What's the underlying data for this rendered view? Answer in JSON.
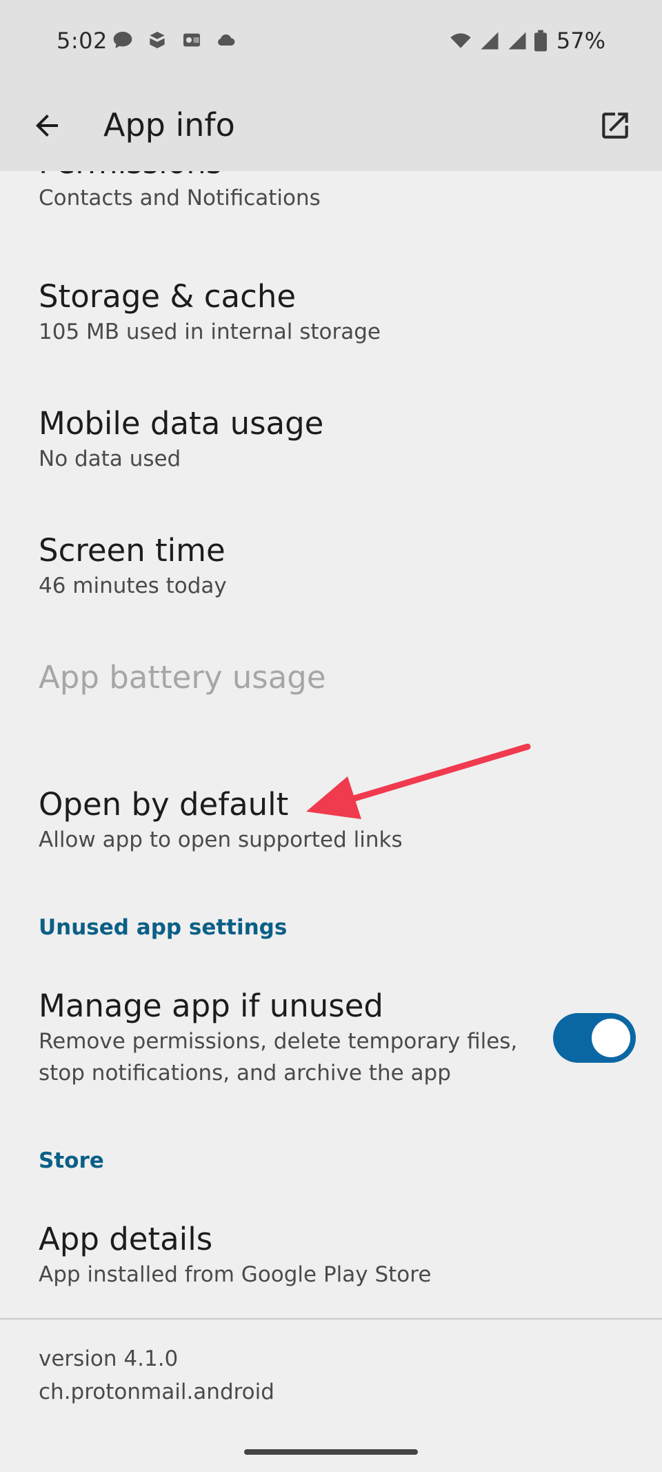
{
  "status_bar": {
    "time": "5:02",
    "battery": "57%",
    "icons_left": [
      "chat-bubble-icon",
      "notification-app-icon",
      "outlook-icon",
      "cloud-icon"
    ],
    "icons_right": [
      "wifi-icon",
      "signal-icon",
      "signal-icon-2",
      "battery-icon"
    ]
  },
  "app_bar": {
    "title": "App info",
    "back_icon": "arrow-back-icon",
    "action_icon": "open-in-new-icon"
  },
  "items": [
    {
      "title": "Permissions",
      "subtitle": "Contacts and Notifications"
    },
    {
      "title": "Storage & cache",
      "subtitle": "105 MB used in internal storage"
    },
    {
      "title": "Mobile data usage",
      "subtitle": "No data used"
    },
    {
      "title": "Screen time",
      "subtitle": "46 minutes today"
    },
    {
      "title": "App battery usage",
      "subtitle": ""
    },
    {
      "title": "Open by default",
      "subtitle": "Allow app to open supported links"
    }
  ],
  "sections": {
    "unused": {
      "header": "Unused app settings",
      "item": {
        "title": "Manage app if unused",
        "subtitle_line1": "Remove permissions, delete temporary files,",
        "subtitle_line2": "stop notifications, and archive the app",
        "toggle_on": true
      }
    },
    "store": {
      "header": "Store",
      "item": {
        "title": "App details",
        "subtitle": "App installed from Google Play Store"
      }
    }
  },
  "footer": {
    "version": "version 4.1.0",
    "package": "ch.protonmail.android"
  },
  "colors": {
    "accent": "#0a67a3",
    "section_header": "#0b5f86",
    "annotation": "#f03a4e",
    "background": "#efefef",
    "app_bar": "#e1e1e1"
  }
}
